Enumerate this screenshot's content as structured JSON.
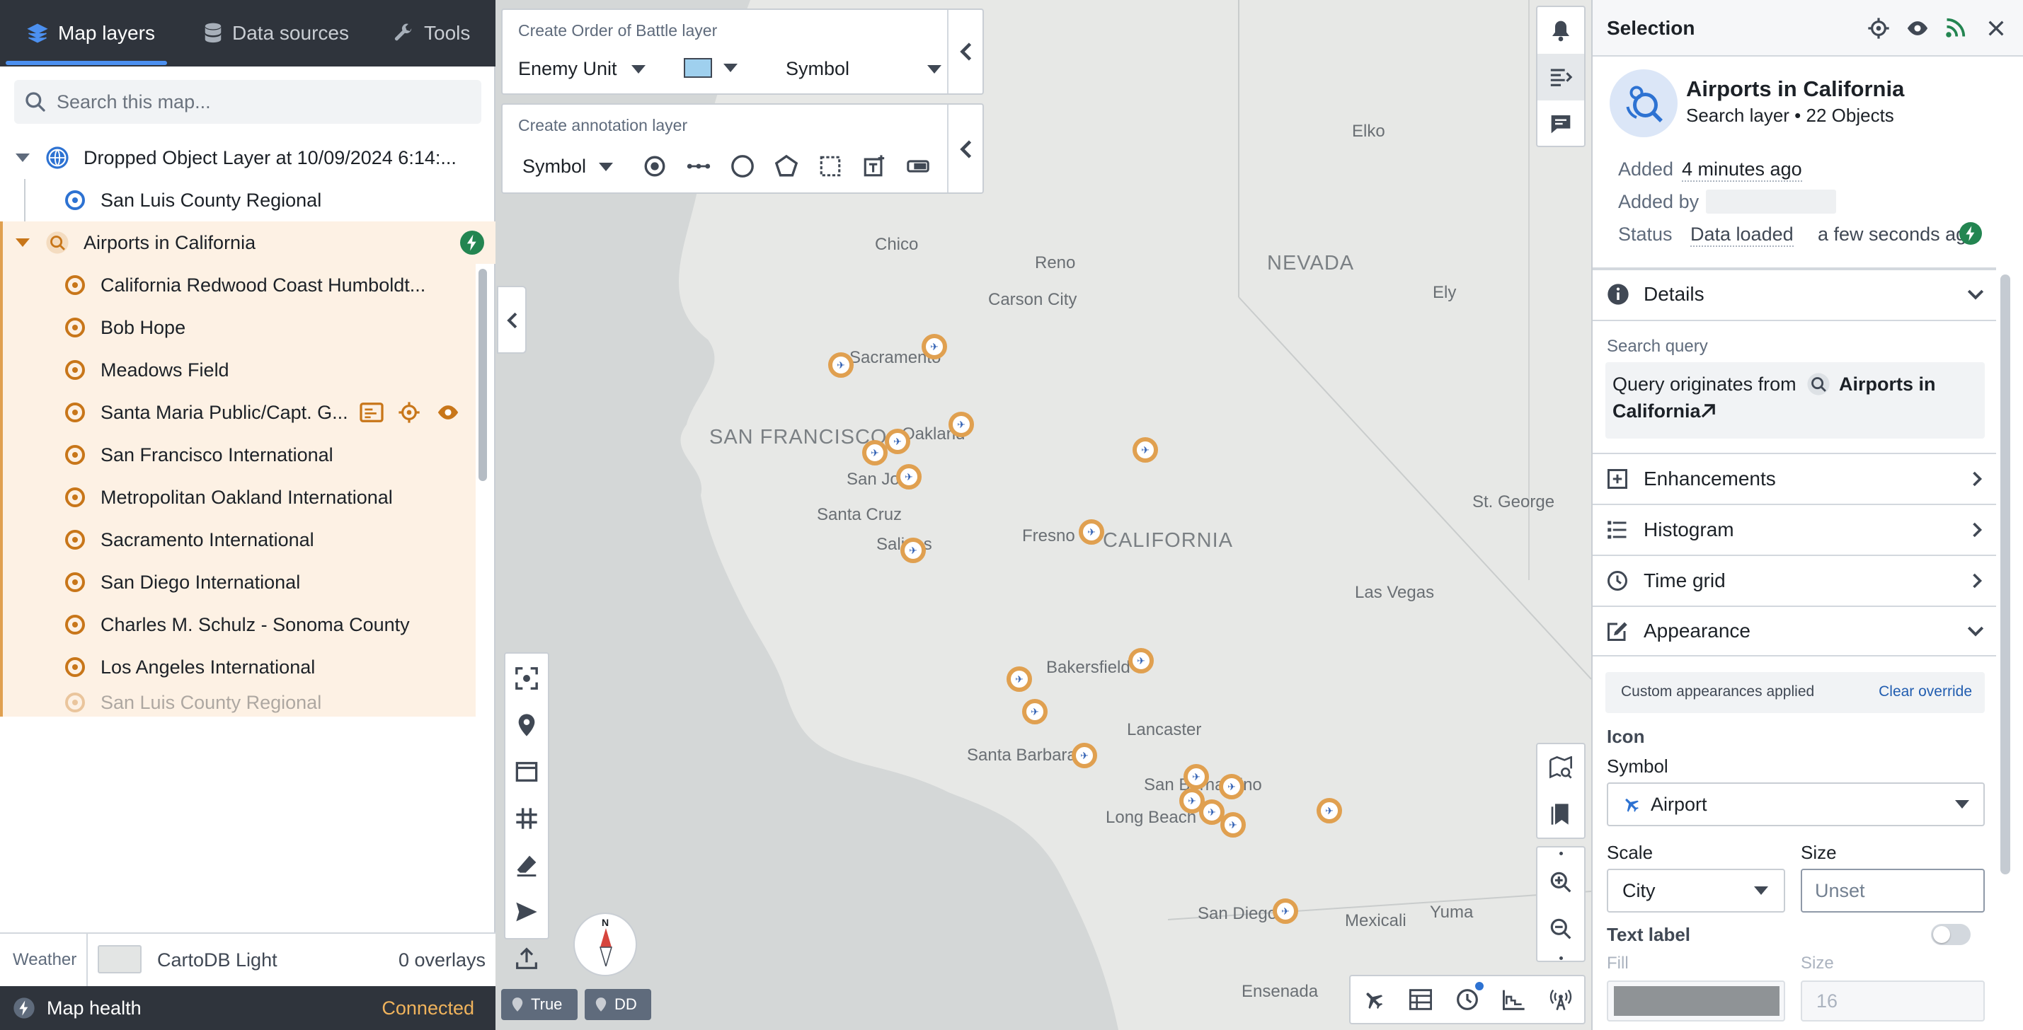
{
  "tabs": [
    {
      "label": "Map layers",
      "icon": "layers-icon",
      "active": true
    },
    {
      "label": "Data sources",
      "icon": "database-icon",
      "active": false
    },
    {
      "label": "Tools",
      "icon": "wrench-icon",
      "active": false
    }
  ],
  "search": {
    "placeholder": "Search this map..."
  },
  "layers": {
    "dropped": {
      "title": "Dropped Object Layer at 10/09/2024 6:14:...",
      "items": [
        "San Luis County Regional"
      ]
    },
    "airports": {
      "title": "Airports in California",
      "items": [
        "California Redwood Coast Humboldt...",
        "Bob Hope",
        "Meadows Field",
        "Santa Maria Public/Capt. G....",
        "San Francisco International",
        "Metropolitan Oakland International",
        "Sacramento International",
        "San Diego International",
        "Charles M. Schulz - Sonoma County",
        "Los Angeles International",
        "San Luis County Regional"
      ]
    }
  },
  "footer": {
    "weather": "Weather",
    "basemap": "CartoDB Light",
    "overlays": "0 overlays",
    "health": "Map health",
    "status": "Connected"
  },
  "orbat": {
    "title": "Create Order of Battle layer",
    "unit": "Enemy Unit",
    "symbol": "Symbol",
    "swatch_color": "#9fd0ee"
  },
  "annotation": {
    "title": "Create annotation layer",
    "symbol": "Symbol"
  },
  "map": {
    "labels": {
      "nevada": "NEVADA",
      "california": "CALIFORNIA",
      "sanfrancisco": "SAN FRANCISCO",
      "elko": "Elko",
      "chico": "Chico",
      "reno": "Reno",
      "carson": "Carson City",
      "ely": "Ely",
      "sacramento": "Sacramento",
      "oakland": "Oakland",
      "sanjose": "San Jose",
      "santacruz": "Santa Cruz",
      "salinas": "Salinas",
      "fresno": "Fresno",
      "stgeorge": "St. George",
      "lasvegas": "Las Vegas",
      "bakersfield": "Bakersfield",
      "lancaster": "Lancaster",
      "santabarbara": "Santa Barbara",
      "sanbernardino": "San Bernardino",
      "longbeach": "Long Beach",
      "sandiego": "San Diego",
      "mexicali": "Mexicali",
      "yuma": "Yuma",
      "ensenada": "Ensenada"
    },
    "compass": "N",
    "north": "True",
    "coord": "DD"
  },
  "selection": {
    "title": "Selection",
    "layer_name": "Airports in California",
    "layer_sub": "Search layer • 22 Objects",
    "added_key": "Added",
    "added_val": "4 minutes ago",
    "addedby_key": "Added by",
    "status_key": "Status",
    "status_val": "Data loaded",
    "status_time": "a few seconds ago",
    "details": "Details",
    "search_query_label": "Search query",
    "query_prefix": "Query originates from",
    "query_name": "Airports in",
    "query_name2": "California",
    "enhancements": "Enhancements",
    "histogram": "Histogram",
    "timegrid": "Time grid",
    "appearance": "Appearance",
    "custom_applied": "Custom appearances applied",
    "clear_override": "Clear override",
    "icon_label": "Icon",
    "symbol_label": "Symbol",
    "symbol_value": "Airport",
    "scale_label": "Scale",
    "scale_value": "City",
    "size_label": "Size",
    "size_placeholder": "Unset",
    "text_label": "Text label",
    "fill_label": "Fill",
    "size2_label": "Size",
    "size2_value": "16"
  }
}
